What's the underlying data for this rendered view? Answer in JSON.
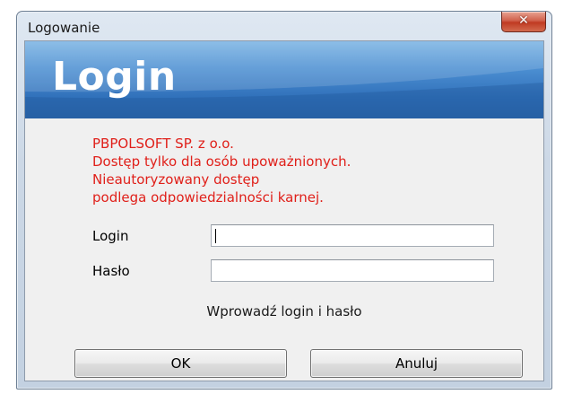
{
  "window": {
    "title": "Logowanie",
    "close_icon": "close-icon"
  },
  "banner": {
    "title": "Login"
  },
  "warning": {
    "line1": "PBPOLSOFT SP. z o.o.",
    "line2": "Dostęp tylko dla osób upoważnionych.",
    "line3": "Nieautoryzowany dostęp",
    "line4": "podlega odpowiedzialności karnej."
  },
  "form": {
    "login_label": "Login",
    "login_value": "",
    "password_label": "Hasło",
    "password_value": "",
    "hint": "Wprowadź login i hasło"
  },
  "buttons": {
    "ok_label": "OK",
    "cancel_label": "Anuluj"
  },
  "colors": {
    "warning_text": "#e0201a",
    "banner_blue": "#2f6fb9",
    "close_red": "#c03a22"
  }
}
